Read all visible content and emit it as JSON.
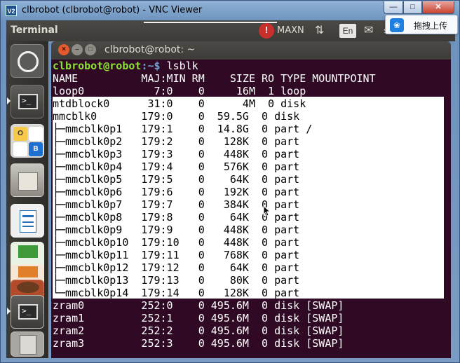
{
  "vnc": {
    "title": "clbrobot (clbrobot@robot) - VNC Viewer",
    "app_icon": "V2",
    "controls": {
      "minimize": "—",
      "maximize": "□",
      "close": "✕"
    }
  },
  "panel": {
    "app_title": "Terminal",
    "maxn_icon": "!",
    "maxn_label": "MAXN",
    "lang": "En",
    "sort_icon": "⇅",
    "mail_icon": "✉",
    "net_icon": "⇆"
  },
  "cloud_tip": {
    "icon": "❀",
    "text": "拖拽上传"
  },
  "launcher": {
    "terminal_glyph": ">_",
    "office_letters": [
      "O",
      "B"
    ]
  },
  "terminal": {
    "window_title": "clbrobot@robot: ~",
    "prompt_user": "clbrobot@robot",
    "prompt_path": ":~$ ",
    "command": "lsblk",
    "header": "NAME          MAJ:MIN RM    SIZE RO TYPE MOUNTPOINT",
    "rows": [
      "loop0           7:0    0     16M  1 loop ",
      "mtdblock0      31:0    0      4M  0 disk ",
      "mmcblk0       179:0    0  59.5G  0 disk ",
      "├─mmcblk0p1   179:1    0  14.8G  0 part /",
      "├─mmcblk0p2   179:2    0   128K  0 part ",
      "├─mmcblk0p3   179:3    0   448K  0 part ",
      "├─mmcblk0p4   179:4    0   576K  0 part ",
      "├─mmcblk0p5   179:5    0    64K  0 part ",
      "├─mmcblk0p6   179:6    0   192K  0 part ",
      "├─mmcblk0p7   179:7    0   384K  0 part ",
      "├─mmcblk0p8   179:8    0    64K  0 part ",
      "├─mmcblk0p9   179:9    0   448K  0 part ",
      "├─mmcblk0p10  179:10   0   448K  0 part ",
      "├─mmcblk0p11  179:11   0   768K  0 part ",
      "├─mmcblk0p12  179:12   0    64K  0 part ",
      "├─mmcblk0p13  179:13   0    80K  0 part ",
      "└─mmcblk0p14  179:14   0   128K  0 part ",
      "zram0         252:0    0 495.6M  0 disk [SWAP]",
      "zram1         252:1    0 495.6M  0 disk [SWAP]",
      "zram2         252:2    0 495.6M  0 disk [SWAP]",
      "zram3         252:3    0 495.6M  0 disk [SWAP]"
    ],
    "selected_rows": "1-16"
  },
  "colors": {
    "terminal_bg": "#300a24",
    "prompt_user": "#8ae234",
    "prompt_path": "#729fcf",
    "selection_bg": "#ffffff"
  }
}
